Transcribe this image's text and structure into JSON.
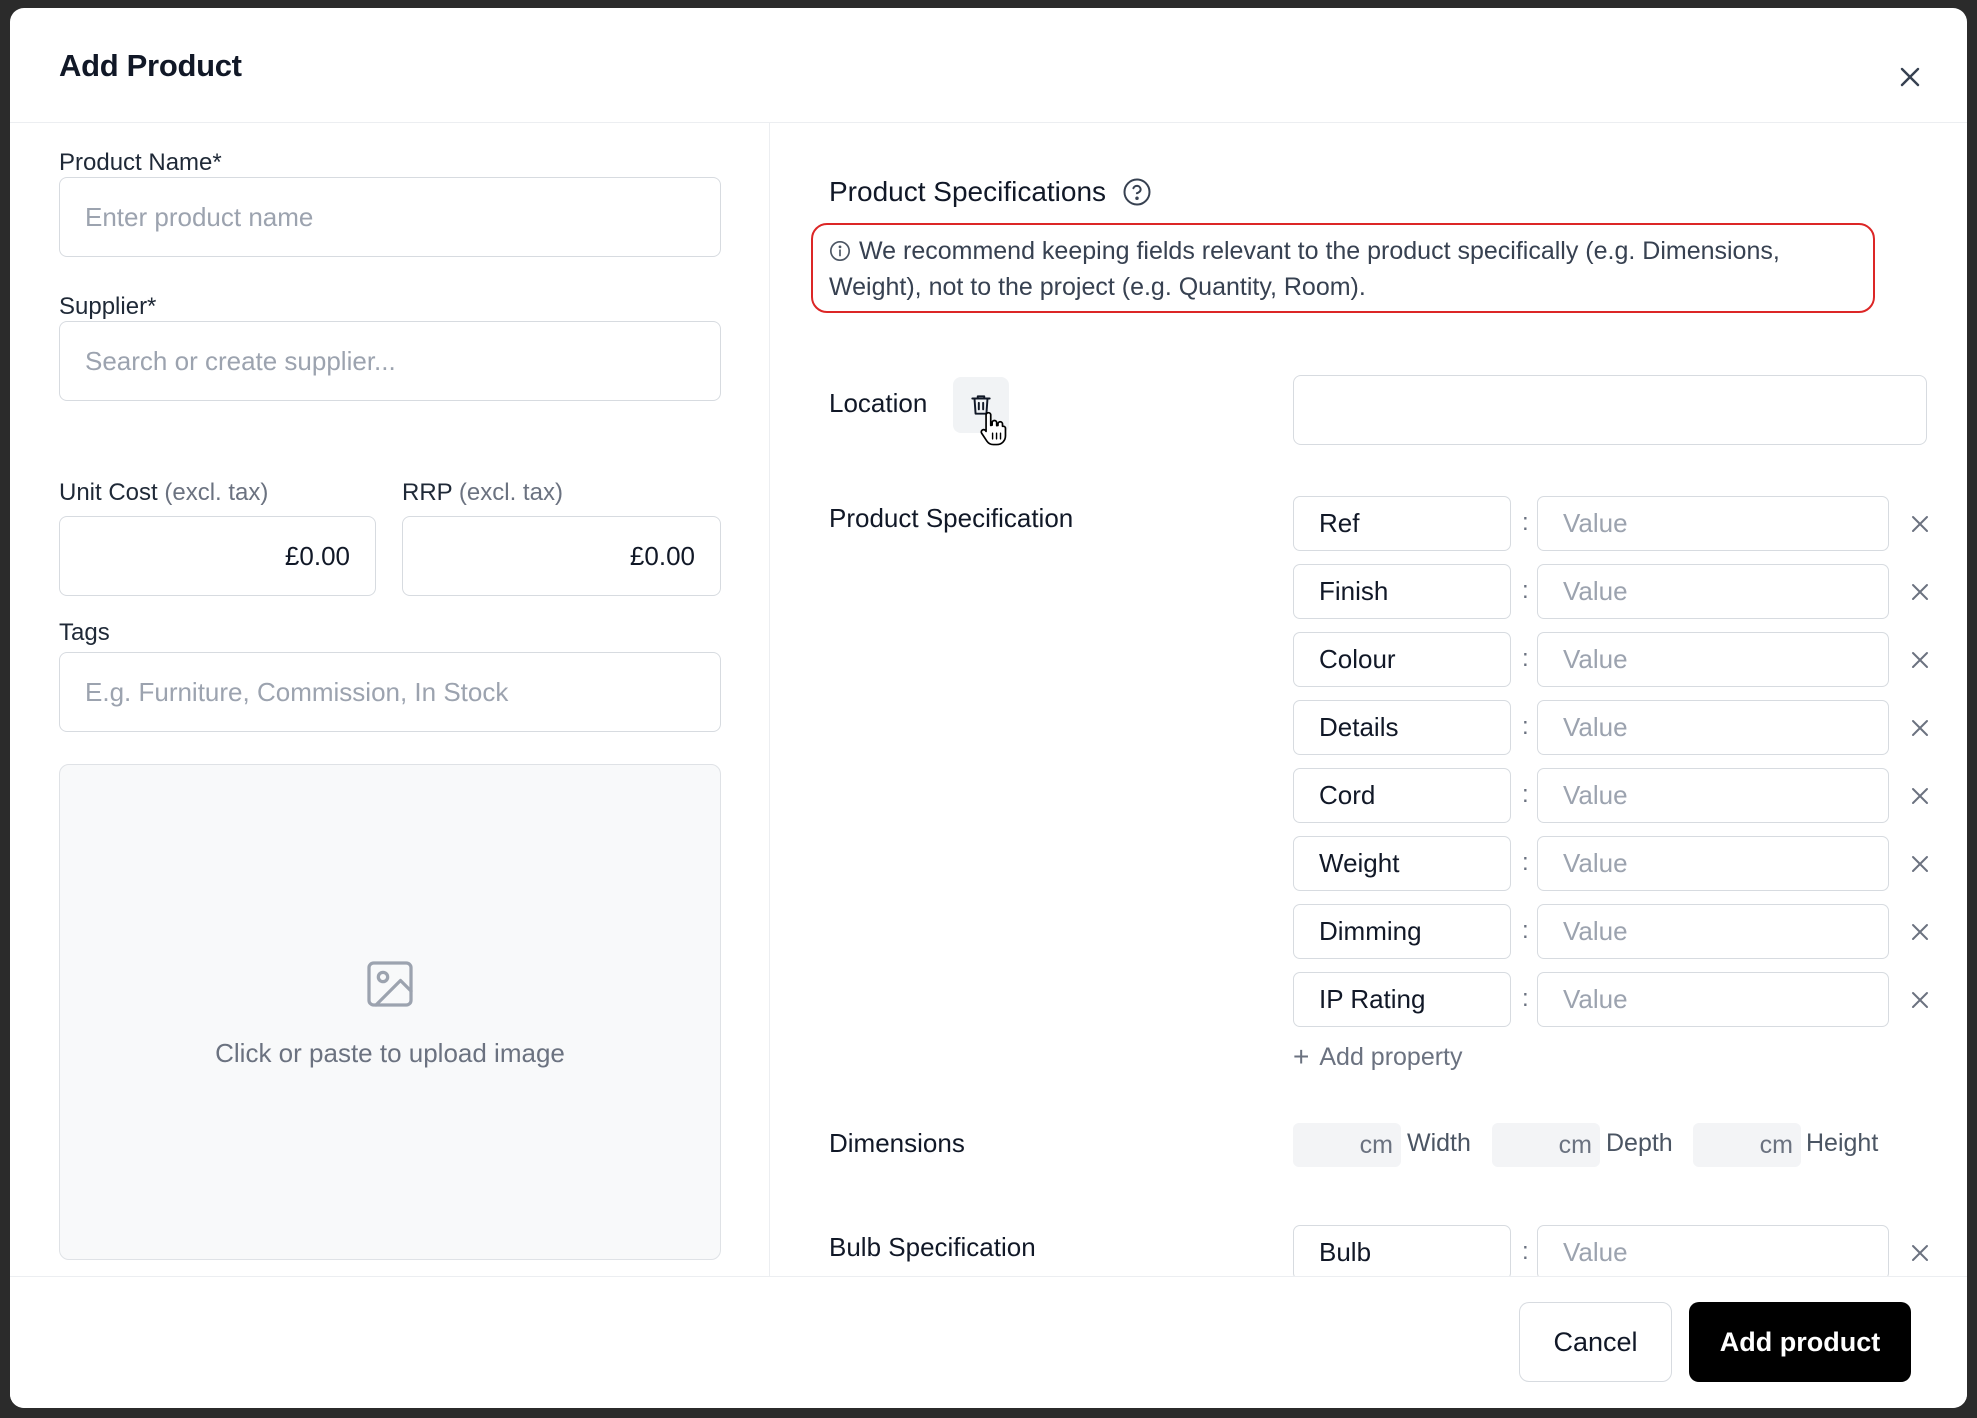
{
  "modal": {
    "title": "Add Product",
    "close_icon": "close-icon"
  },
  "left": {
    "product_name": {
      "label": "Product Name*",
      "placeholder": "Enter product name"
    },
    "supplier": {
      "label": "Supplier*",
      "placeholder": "Search or create supplier..."
    },
    "unit_cost": {
      "label": "Unit Cost",
      "label_muted": "(excl. tax)",
      "value": "£0.00"
    },
    "rrp": {
      "label": "RRP",
      "label_muted": "(excl. tax)",
      "value": "£0.00"
    },
    "tags": {
      "label": "Tags",
      "placeholder": "E.g. Furniture, Commission, In Stock"
    },
    "upload": {
      "text": "Click or paste to upload image",
      "icon": "image-icon"
    }
  },
  "right": {
    "title": "Product Specifications",
    "help_icon": "help-circle-icon",
    "notice": {
      "icon": "info-icon",
      "text": "We recommend keeping fields relevant to the product specifically (e.g. Dimensions, Weight), not to the project (e.g. Quantity, Room)."
    },
    "location": {
      "label": "Location",
      "value": "",
      "delete_icon": "trash-icon"
    },
    "product_specification": {
      "label": "Product Specification",
      "rows": [
        {
          "key": "Ref",
          "value_placeholder": "Value"
        },
        {
          "key": "Finish",
          "value_placeholder": "Value"
        },
        {
          "key": "Colour",
          "value_placeholder": "Value"
        },
        {
          "key": "Details",
          "value_placeholder": "Value"
        },
        {
          "key": "Cord",
          "value_placeholder": "Value"
        },
        {
          "key": "Weight",
          "value_placeholder": "Value"
        },
        {
          "key": "Dimming",
          "value_placeholder": "Value"
        },
        {
          "key": "IP Rating",
          "value_placeholder": "Value"
        }
      ],
      "add_label": "Add property",
      "separator": ":"
    },
    "dimensions": {
      "label": "Dimensions",
      "unit": "cm",
      "fields": [
        "Width",
        "Depth",
        "Height"
      ]
    },
    "bulb_specification": {
      "label": "Bulb Specification",
      "rows": [
        {
          "key": "Bulb",
          "value_placeholder": "Value"
        }
      ]
    }
  },
  "footer": {
    "cancel_label": "Cancel",
    "submit_label": "Add product"
  }
}
